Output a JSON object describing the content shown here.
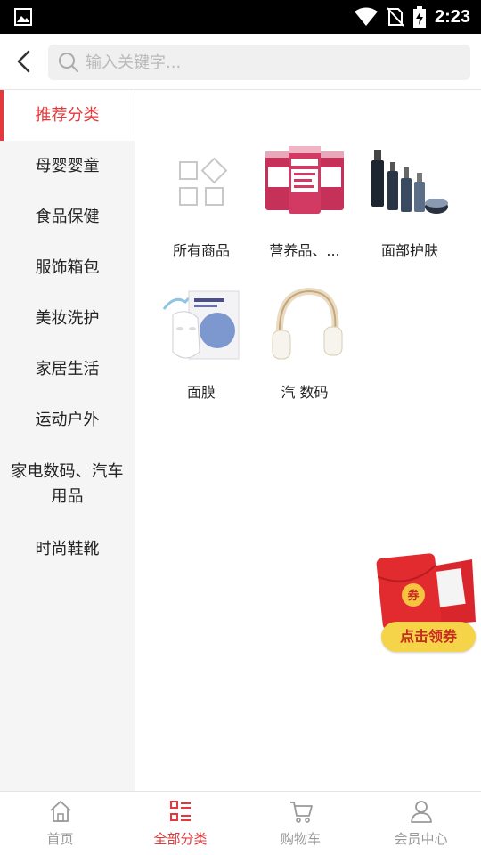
{
  "status_bar": {
    "time": "2:23",
    "icons": [
      "gallery-icon",
      "wifi-icon",
      "no-sim-icon",
      "battery-charging-icon"
    ]
  },
  "search": {
    "placeholder": "输入关键字..."
  },
  "sidebar": {
    "items": [
      {
        "label": "推荐分类",
        "active": true
      },
      {
        "label": "母婴婴童",
        "active": false
      },
      {
        "label": "食品保健",
        "active": false
      },
      {
        "label": "服饰箱包",
        "active": false
      },
      {
        "label": "美妆洗护",
        "active": false
      },
      {
        "label": "家居生活",
        "active": false
      },
      {
        "label": "运动户外",
        "active": false
      },
      {
        "label": "家电数码、汽车用品",
        "active": false
      },
      {
        "label": "时尚鞋靴",
        "active": false
      }
    ]
  },
  "categories": [
    {
      "label": "所有商品",
      "icon": "grid-icon"
    },
    {
      "label": "营养品、...",
      "icon": "supplement-bottles-image"
    },
    {
      "label": "面部护肤",
      "icon": "skincare-bottles-image"
    },
    {
      "label": "面膜",
      "icon": "face-mask-image"
    },
    {
      "label": "汽 数码",
      "icon": "headphones-image"
    }
  ],
  "coupon": {
    "badge": "券",
    "button_label": "点击领券"
  },
  "tabbar": {
    "items": [
      {
        "label": "首页",
        "icon": "home-icon",
        "active": false
      },
      {
        "label": "全部分类",
        "icon": "category-list-icon",
        "active": true
      },
      {
        "label": "购物车",
        "icon": "cart-icon",
        "active": false
      },
      {
        "label": "会员中心",
        "icon": "user-icon",
        "active": false
      }
    ]
  },
  "colors": {
    "accent": "#e4393c",
    "sidebar_bg": "#f5f5f5",
    "coupon_red": "#d9262c",
    "coupon_gold": "#f6d44a"
  }
}
